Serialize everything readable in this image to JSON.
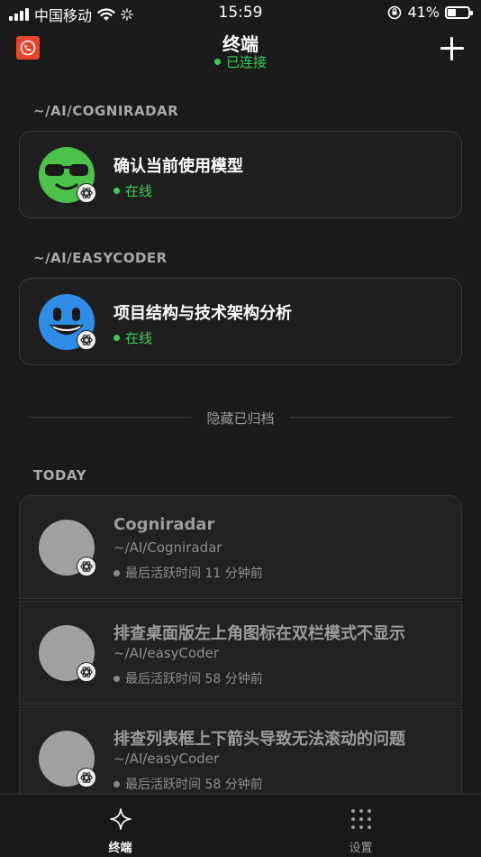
{
  "status_bar": {
    "carrier": "中国移动",
    "time": "15:59",
    "battery_percent": "41%",
    "battery_level": 0.41
  },
  "nav": {
    "title": "终端",
    "connection_status": "已连接"
  },
  "projects": [
    {
      "path": "~/AI/COGNIRADAR",
      "session_title": "确认当前使用模型",
      "status": "在线",
      "avatar_color": "#4cc24a"
    },
    {
      "path": "~/AI/EASYCODER",
      "session_title": "项目结构与技术架构分析",
      "status": "在线",
      "avatar_color": "#2f8de8"
    }
  ],
  "archive_toggle": "隐藏已归档",
  "today": {
    "header": "TODAY",
    "items": [
      {
        "title": "Cogniradar",
        "path": "~/AI/Cogniradar",
        "meta": "最后活跃时间 11 分钟前"
      },
      {
        "title": "排查桌面版左上角图标在双栏模式不显示",
        "path": "~/AI/easyCoder",
        "meta": "最后活跃时间 58 分钟前"
      },
      {
        "title": "排查列表框上下箭头导致无法滚动的问题",
        "path": "~/AI/easyCoder",
        "meta": "最后活跃时间 58 分钟前"
      }
    ]
  },
  "tabs": [
    {
      "label": "终端",
      "icon": "sparkle-icon",
      "active": true
    },
    {
      "label": "设置",
      "icon": "grid-icon",
      "active": false
    }
  ],
  "colors": {
    "background": "#1b1b1b",
    "online_green": "#3ecf5a",
    "app_logo": "#e8442c"
  }
}
